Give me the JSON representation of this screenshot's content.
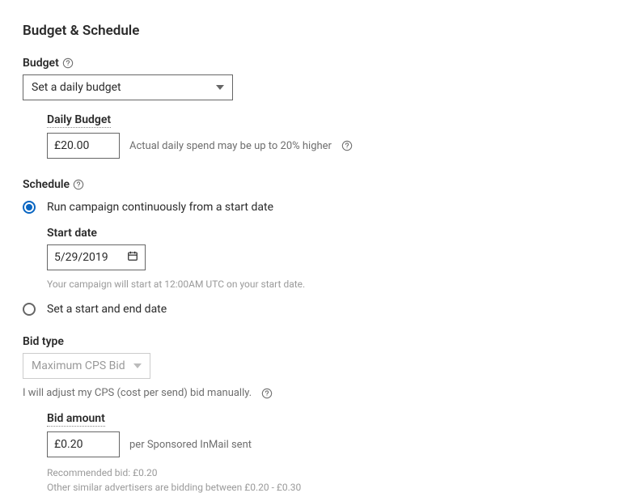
{
  "section_title": "Budget & Schedule",
  "budget": {
    "label": "Budget",
    "dropdown_value": "Set a daily budget",
    "daily_budget_label": "Daily Budget",
    "daily_budget_value": "£20.00",
    "daily_budget_hint": "Actual daily spend may be up to 20% higher"
  },
  "schedule": {
    "label": "Schedule",
    "option_continuous": "Run campaign continuously from a start date",
    "start_date_label": "Start date",
    "start_date_value": "5/29/2019",
    "start_date_hint": "Your campaign will start at 12:00AM UTC on your start date.",
    "option_range": "Set a start and end date"
  },
  "bid": {
    "type_label": "Bid type",
    "type_value": "Maximum CPS Bid",
    "manual_hint": "I will adjust my CPS (cost per send) bid manually.",
    "amount_label": "Bid amount",
    "amount_value": "£0.20",
    "amount_unit": "per Sponsored InMail sent",
    "recommended": "Recommended bid: £0.20",
    "range_hint": "Other similar advertisers are bidding between £0.20 - £0.30"
  }
}
